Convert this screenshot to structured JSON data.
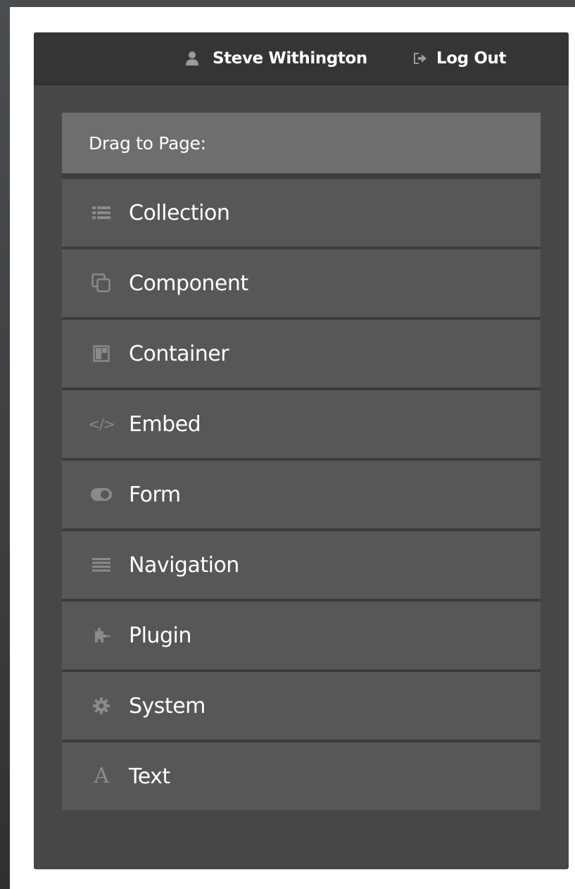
{
  "topbar": {
    "user_name": "Steve Withington",
    "user_icon": "user-icon",
    "logout_label": "Log Out",
    "logout_icon": "sign-out-icon"
  },
  "palette": {
    "header_label": "Drag to Page:",
    "items": [
      {
        "label": "Collection",
        "icon": "list-icon"
      },
      {
        "label": "Component",
        "icon": "clone-icon"
      },
      {
        "label": "Container",
        "icon": "container-icon"
      },
      {
        "label": "Embed",
        "icon": "code-icon"
      },
      {
        "label": "Form",
        "icon": "toggle-icon"
      },
      {
        "label": "Navigation",
        "icon": "bars-icon"
      },
      {
        "label": "Plugin",
        "icon": "puzzle-icon"
      },
      {
        "label": "System",
        "icon": "gear-icon"
      },
      {
        "label": "Text",
        "icon": "text-icon"
      }
    ]
  },
  "colors": {
    "panel_bg": "#474747",
    "topbar_bg": "#353535",
    "header_bg": "#6e6e6e",
    "item_bg": "#575757",
    "icon_color": "#8a8a8a",
    "text_color": "#ffffff"
  }
}
